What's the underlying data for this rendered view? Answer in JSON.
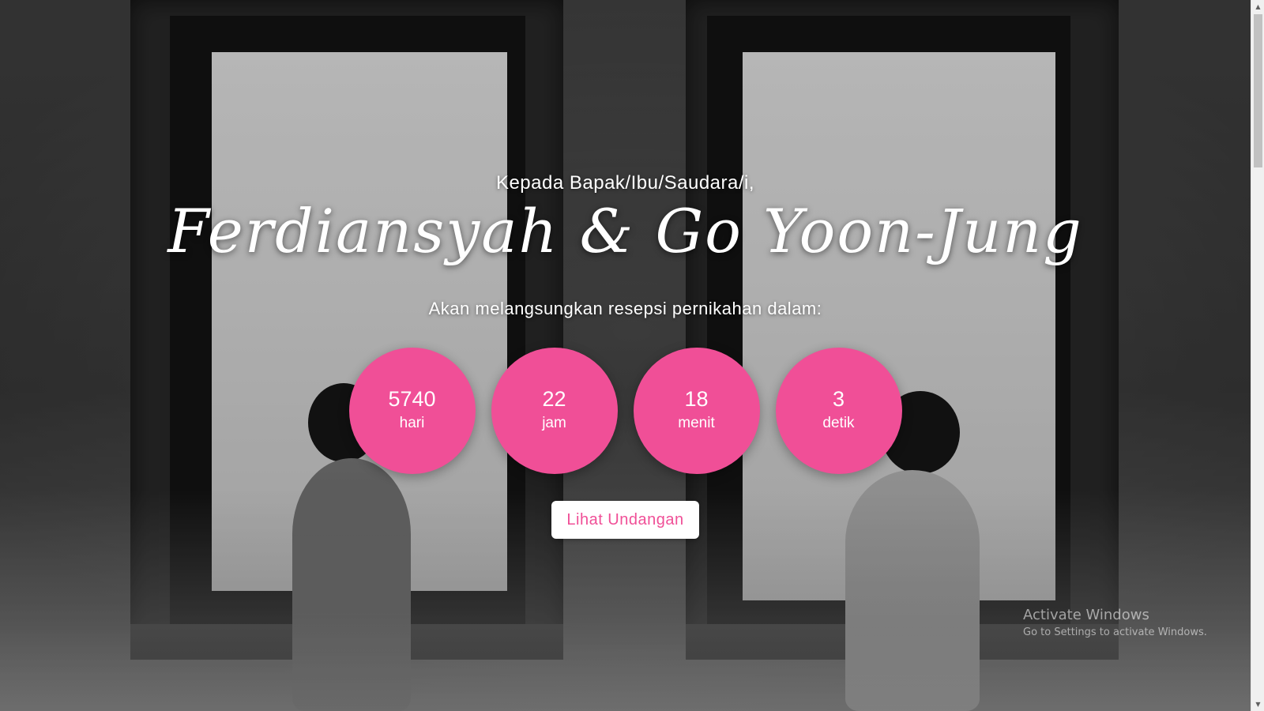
{
  "hero": {
    "greeting": "Kepada Bapak/Ibu/Saudara/i,",
    "couple_names": "Ferdiansyah & Go Yoon-Jung",
    "subtitle": "Akan melangsungkan resepsi pernikahan dalam:"
  },
  "countdown": [
    {
      "value": "5740",
      "unit": "hari"
    },
    {
      "value": "22",
      "unit": "jam"
    },
    {
      "value": "18",
      "unit": "menit"
    },
    {
      "value": "3",
      "unit": "detik"
    }
  ],
  "button": {
    "label": "Lihat Undangan"
  },
  "watermark": {
    "title": "Activate Windows",
    "subtitle": "Go to Settings to activate Windows."
  },
  "colors": {
    "accent": "#f04f97",
    "button_bg": "#ffffff"
  },
  "icons": {
    "scroll_up": "triangle-up-icon",
    "scroll_down": "triangle-down-icon"
  }
}
